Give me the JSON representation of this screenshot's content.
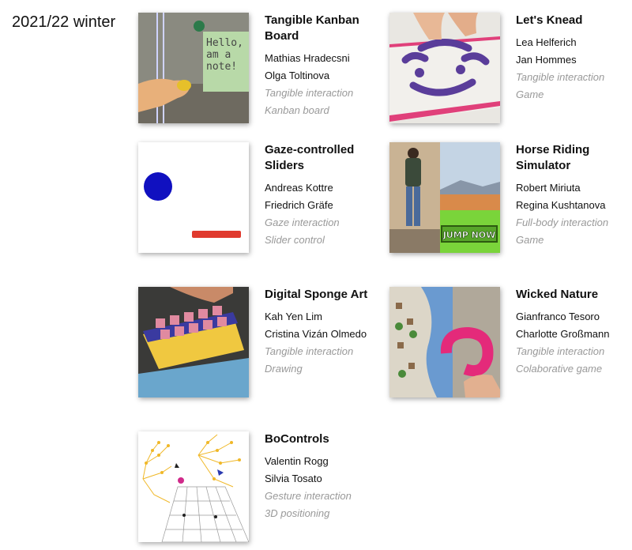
{
  "semester": "2021/22 winter",
  "projects": [
    {
      "title": "Tangible Kanban Board",
      "authors": [
        "Mathias Hradecsni",
        "Olga Toltinova"
      ],
      "tags": [
        "Tangible interaction",
        "Kanban board"
      ],
      "thumb_text": "Hello, I am a note!"
    },
    {
      "title": "Let's Knead",
      "authors": [
        "Lea Helferich",
        "Jan Hommes"
      ],
      "tags": [
        "Tangible interaction",
        "Game"
      ]
    },
    {
      "title": "Gaze-controlled Sliders",
      "authors": [
        "Andreas Kottre",
        "Friedrich Gräfe"
      ],
      "tags": [
        "Gaze interaction",
        "Slider control"
      ]
    },
    {
      "title": "Horse Riding Simulator",
      "authors": [
        "Robert Miriuta",
        "Regina Kushtanova"
      ],
      "tags": [
        "Full-body interaction",
        "Game"
      ],
      "thumb_text": "JUMP NOW"
    },
    {
      "title": "Digital Sponge Art",
      "authors": [
        "Kah Yen Lim",
        "Cristina Vizán Olmedo"
      ],
      "tags": [
        "Tangible interaction",
        "Drawing"
      ]
    },
    {
      "title": "Wicked Nature",
      "authors": [
        "Gianfranco Tesoro",
        "Charlotte Großmann"
      ],
      "tags": [
        "Tangible interaction",
        "Colaborative game"
      ]
    },
    {
      "title": "BoControls",
      "authors": [
        "Valentin Rogg",
        "Silvia Tosato"
      ],
      "tags": [
        "Gesture interaction",
        "3D positioning"
      ]
    }
  ]
}
